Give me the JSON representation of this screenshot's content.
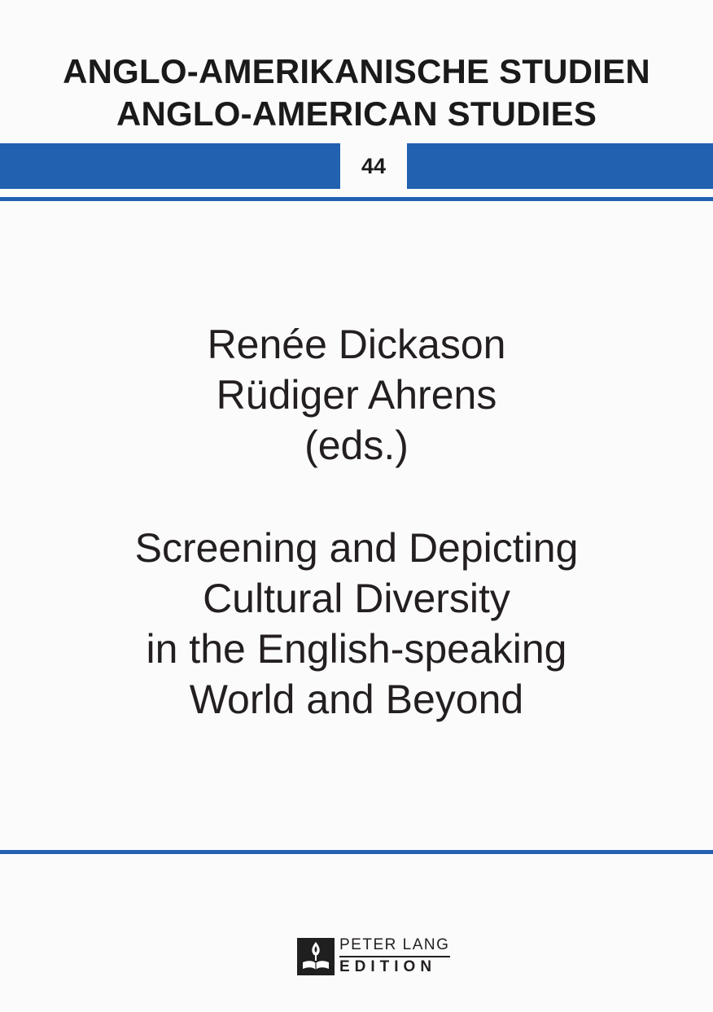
{
  "series": {
    "title_de": "ANGLO-AMERIKANISCHE STUDIEN",
    "title_en": "ANGLO-AMERICAN STUDIES",
    "volume": "44"
  },
  "editors": {
    "names": [
      "Renée Dickason",
      "Rüdiger Ahrens"
    ],
    "role": "(eds.)"
  },
  "book_title": {
    "lines": [
      "Screening and Depicting",
      "Cultural Diversity",
      "in the English-speaking",
      "World and Beyond"
    ]
  },
  "publisher": {
    "name": "PETER LANG",
    "imprint": "EDITION",
    "logo_icon": "peter-lang-tree-book-logo-icon"
  },
  "colors": {
    "accent_blue": "#2260b0",
    "text": "#231f20",
    "background": "#fbfbfb"
  }
}
